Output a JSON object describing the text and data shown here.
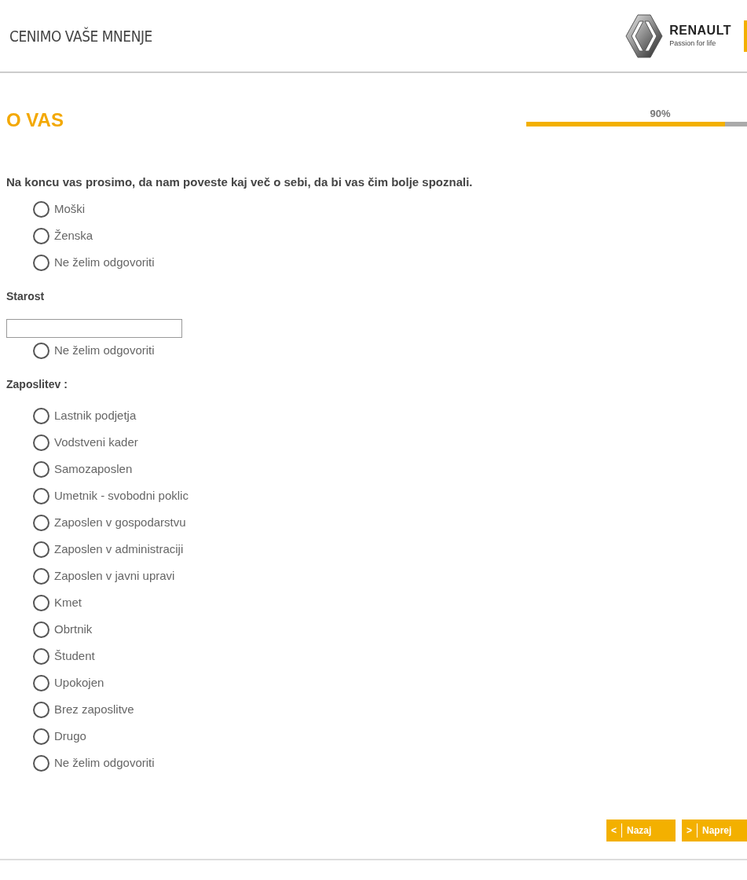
{
  "header": {
    "title": "CENIMO VAŠE MNENJE",
    "logo": {
      "brand": "RENAULT",
      "tagline": "Passion for life"
    }
  },
  "section": {
    "title": "O VAS",
    "progress": {
      "label": "90%",
      "level": 0.9
    }
  },
  "intro": "Na koncu vas prosimo, da nam poveste kaj več o sebi, da bi vas čim bolje spoznali.",
  "gender": {
    "options": [
      {
        "label": "Moški",
        "selected": false
      },
      {
        "label": "Ženska",
        "selected": false
      },
      {
        "label": "Ne želim odgovoriti",
        "selected": false
      }
    ]
  },
  "age": {
    "label": "Starost",
    "options": [
      {
        "label": "Ne želim odgovoriti",
        "selected": false
      }
    ]
  },
  "employment": {
    "label": "Zaposlitev :",
    "options": [
      {
        "label": "Lastnik podjetja",
        "selected": false
      },
      {
        "label": "Vodstveni kader",
        "selected": false
      },
      {
        "label": "Samozaposlen",
        "selected": false
      },
      {
        "label": "Umetnik - svobodni poklic",
        "selected": false
      },
      {
        "label": "Zaposlen v gospodarstvu",
        "selected": false
      },
      {
        "label": "Zaposlen v administraciji",
        "selected": false
      },
      {
        "label": "Zaposlen v javni upravi",
        "selected": false
      },
      {
        "label": "Kmet",
        "selected": false
      },
      {
        "label": "Obrtnik",
        "selected": false
      },
      {
        "label": "Študent",
        "selected": false
      },
      {
        "label": "Upokojen",
        "selected": false
      },
      {
        "label": "Brez zaposlitve",
        "selected": false
      },
      {
        "label": "Drugo",
        "selected": false
      },
      {
        "label": "Ne želim odgovoriti",
        "selected": false
      }
    ]
  },
  "buttons": [
    {
      "symbol": "<",
      "label": "Nazaj"
    },
    {
      "symbol": ">",
      "label": "Naprej"
    }
  ]
}
